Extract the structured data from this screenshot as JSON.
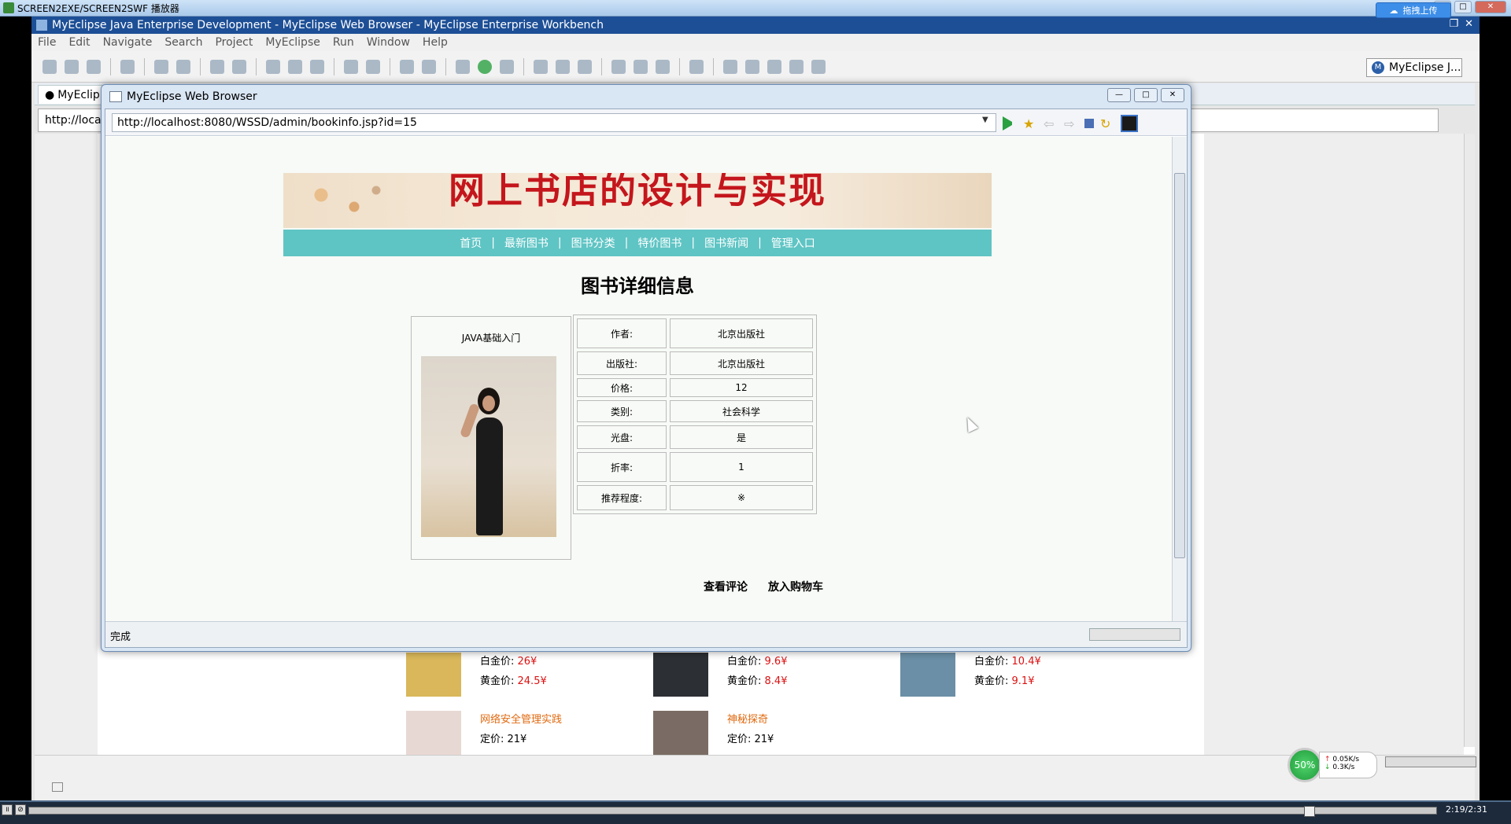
{
  "player": {
    "title": "SCREEN2EXE/SCREEN2SWF 播放器"
  },
  "eclipse": {
    "title": "MyEclipse Java Enterprise Development - MyEclipse Web Browser - MyEclipse Enterprise Workbench",
    "upload_label": "拖拽上传",
    "menu": [
      "File",
      "Edit",
      "Navigate",
      "Search",
      "Project",
      "MyEclipse",
      "Run",
      "Window",
      "Help"
    ],
    "perspective_label": "MyEclipse J...",
    "bg_tab_label": "MyEclip",
    "bg_url": "http://loca"
  },
  "browser": {
    "window_title": "MyEclipse Web Browser",
    "url": "http://localhost:8080/WSSD/admin/bookinfo.jsp?id=15",
    "status": "完成"
  },
  "site": {
    "banner_title": "网上书店的设计与实现",
    "nav": [
      "首页",
      "最新图书",
      "图书分类",
      "特价图书",
      "图书新闻",
      "管理入口"
    ],
    "nav_separator": "|",
    "page_title": "图书详细信息"
  },
  "book": {
    "name": "JAVA基础入门",
    "details": [
      {
        "label": "作者:",
        "value": "北京出版社"
      },
      {
        "label": "出版社:",
        "value": "北京出版社"
      },
      {
        "label": "价格:",
        "value": "12"
      },
      {
        "label": "类别:",
        "value": "社会科学"
      },
      {
        "label": "光盘:",
        "value": "是"
      },
      {
        "label": "折率:",
        "value": "1"
      },
      {
        "label": "推荐程度:",
        "value": "※"
      }
    ],
    "actions": {
      "reviews": "查看评论",
      "add_to_cart": "放入购物车"
    }
  },
  "background_products": [
    {
      "l1": "白金价: ",
      "v1": "26¥",
      "l2": "黄金价: ",
      "v2": "24.5¥",
      "thumb": "#d9b75a"
    },
    {
      "l1": "白金价: ",
      "v1": "9.6¥",
      "l2": "黄金价: ",
      "v2": "8.4¥",
      "thumb": "#2c2f33"
    },
    {
      "l1": "白金价: ",
      "v1": "10.4¥",
      "l2": "黄金价: ",
      "v2": "9.1¥",
      "thumb": "#6a8fa6"
    },
    {
      "name": "网络安全管理实践",
      "l1": "定价: ",
      "v1": "21¥",
      "thumb": "#e8d8d4"
    },
    {
      "name": "神秘探奇",
      "l1": "定价: ",
      "v1": "21¥",
      "thumb": "#7a6c64"
    }
  ],
  "network": {
    "percent": "50%",
    "up": "0.05K/s",
    "down": "0.3K/s"
  },
  "player_time": "2:19/2:31"
}
